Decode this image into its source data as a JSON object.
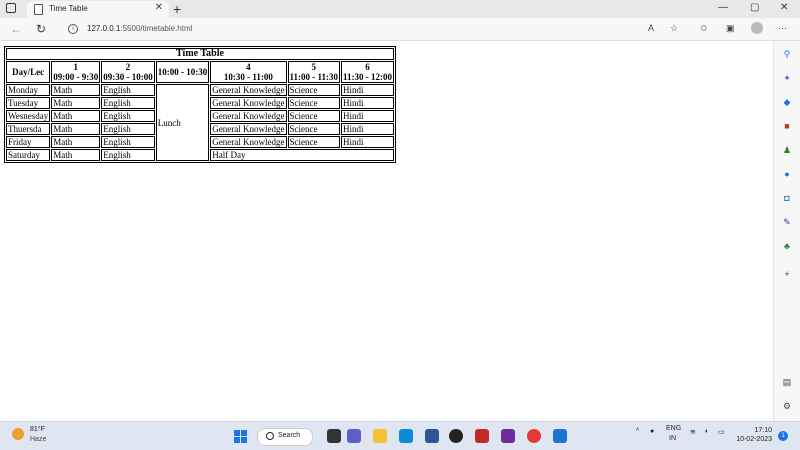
{
  "browser": {
    "tab_title": "Time Table",
    "tab_close": "✕",
    "new_tab": "+",
    "url_host": "127.0.0.1",
    "url_rest": ":5500/timetable.html",
    "window_controls": [
      "—",
      "▢",
      "✕"
    ]
  },
  "timetable": {
    "caption": "Time Table",
    "headers": [
      {
        "num": "",
        "time": "Day/Lec"
      },
      {
        "num": "1",
        "time": "09:00 - 9:30"
      },
      {
        "num": "2",
        "time": "09:30 - 10:00"
      },
      {
        "num": "",
        "time": "10:00 - 10:30"
      },
      {
        "num": "4",
        "time": "10:30 - 11:00"
      },
      {
        "num": "5",
        "time": "11:00 - 11:30"
      },
      {
        "num": "6",
        "time": "11:30 - 12:00"
      }
    ],
    "lunch": "Lunch",
    "rows": [
      {
        "day": "Monday",
        "c1": "Math",
        "c2": "English",
        "c4": "General Knowledge",
        "c5": "Science",
        "c6": "Hindi"
      },
      {
        "day": "Tuesday",
        "c1": "Math",
        "c2": "English",
        "c4": "General Knowledge",
        "c5": "Science",
        "c6": "Hindi"
      },
      {
        "day": "Wesnesday",
        "c1": "Math",
        "c2": "English",
        "c4": "General Knowledge",
        "c5": "Science",
        "c6": "Hindi"
      },
      {
        "day": "Thuersda",
        "c1": "Math",
        "c2": "English",
        "c4": "General Knowledge",
        "c5": "Science",
        "c6": "Hindi"
      },
      {
        "day": "Friday",
        "c1": "Math",
        "c2": "English",
        "c4": "General Knowledge",
        "c5": "Science",
        "c6": "Hindi"
      },
      {
        "day": "Saturday",
        "c1": "Math",
        "c2": "English",
        "half": "Half Day"
      }
    ]
  },
  "taskbar": {
    "temperature": "81°F",
    "condition": "Haze",
    "search_label": "Search",
    "lang_top": "ENG",
    "lang_bottom": "IN",
    "time": "17:10",
    "date": "10-02-2023",
    "notification_count": "1"
  },
  "icons": {
    "tab_icon": "document-icon",
    "info": "info-icon",
    "colors": {
      "accent": "#1a73e8",
      "taskbar": "#dfe6f1"
    }
  }
}
